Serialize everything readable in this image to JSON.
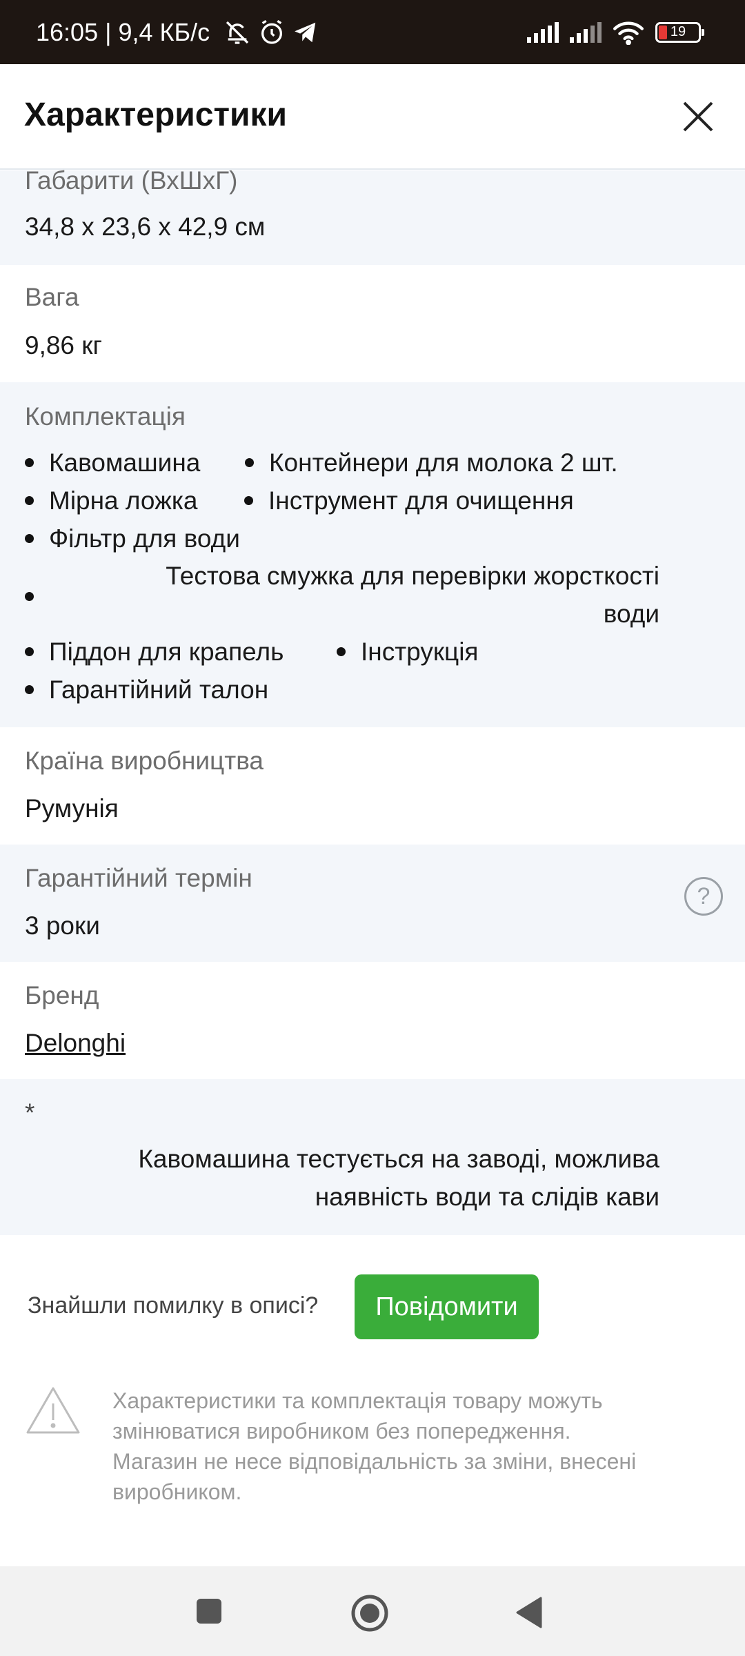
{
  "status_bar": {
    "time_speed": "16:05 | 9,4 КБ/с",
    "battery": "19",
    "icons": [
      "mute-icon",
      "alarm-icon",
      "telegram-icon",
      "signal-icon",
      "signal-icon",
      "wifi-icon",
      "battery-icon"
    ]
  },
  "header": {
    "title": "Характеристики",
    "close_icon": "close-icon"
  },
  "specs": {
    "dimensions": {
      "label": "Габарити (ВхШхГ)",
      "value": "34,8 х 23,6 х 42,9 см"
    },
    "weight": {
      "label": "Вага",
      "value": "9,86 кг"
    },
    "package": {
      "label": "Комплектація",
      "items": [
        "Кавомашина",
        "Контейнери для молока 2 шт.",
        "Мірна ложка",
        "Інструмент для очищення",
        "Фільтр для води",
        "Тестова смужка для перевірки жорсткості води",
        "Піддон для крапель",
        "Інструкція",
        "Гарантійний талон"
      ],
      "long_item_lines": [
        "Тестова смужка для перевірки жорсткості",
        "води"
      ]
    },
    "country": {
      "label": "Країна виробництва",
      "value": "Румунія"
    },
    "warranty": {
      "label": "Гарантійний термін",
      "value": "3 роки",
      "help_icon": "help-icon"
    },
    "brand": {
      "label": "Бренд",
      "value": "Delonghi"
    },
    "note": {
      "asterisk": "*",
      "lines": [
        "Кавомашина тестується на заводі, можлива",
        "наявність води та слідів кави"
      ]
    }
  },
  "report": {
    "text": "Знайшли помилку в описі?",
    "button": "Повідомити"
  },
  "disclaimer": {
    "icon": "warning-icon",
    "lines": [
      "Характеристики та комплектація товару можуть",
      "змінюватися виробником без попередження.",
      "Магазин не несе відповідальність за зміни, внесені",
      "виробником."
    ]
  },
  "colors": {
    "accent_green": "#3aad3a",
    "row_alt_bg": "#f3f6fa",
    "status_bar_bg": "#1e1612"
  }
}
